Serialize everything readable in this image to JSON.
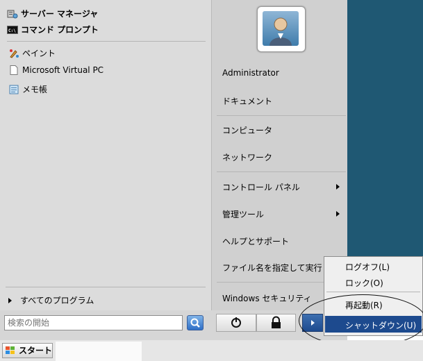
{
  "left_pane": {
    "pinned": [
      {
        "label": "サーバー マネージャ",
        "icon": "server-manager-icon"
      },
      {
        "label": "コマンド プロンプト",
        "icon": "command-prompt-icon"
      }
    ],
    "recent": [
      {
        "label": "ペイント",
        "icon": "paint-icon"
      },
      {
        "label": "Microsoft Virtual PC",
        "icon": "document-icon"
      },
      {
        "label": "メモ帳",
        "icon": "notepad-icon"
      }
    ],
    "all_programs": "すべてのプログラム"
  },
  "right_pane": {
    "user": "Administrator",
    "items": [
      {
        "label": "ドキュメント"
      },
      {
        "label": "コンピュータ"
      },
      {
        "label": "ネットワーク"
      },
      {
        "label": "コントロール パネル"
      },
      {
        "label": "管理ツール"
      },
      {
        "label": "ヘルプとサポート"
      },
      {
        "label": "ファイル名を指定して実行"
      },
      {
        "label": "Windows セキュリティ"
      }
    ]
  },
  "search": {
    "placeholder": "検索の開始"
  },
  "power_menu": {
    "items": [
      "ログオフ(L)",
      "ロック(O)",
      "再起動(R)",
      "シャットダウン(U)"
    ],
    "selected": "シャットダウン(U)"
  },
  "taskbar": {
    "start_label": "スタート"
  },
  "colors": {
    "desktop": "#1f5873",
    "highlight": "#1d4a8e",
    "menu_bg": "#dcdcdc"
  }
}
